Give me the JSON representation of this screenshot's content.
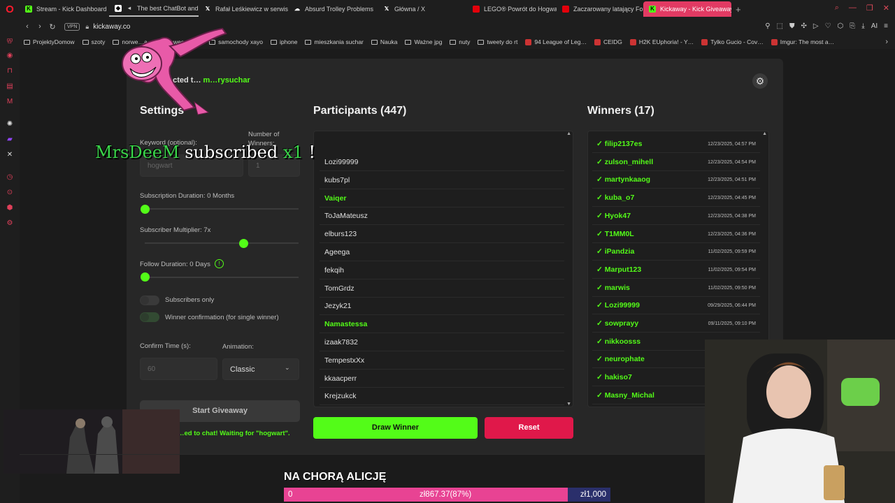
{
  "tabs": [
    {
      "label": "Stream - Kick Dashboard",
      "icon": "kick-icon",
      "color": "#53fc18"
    },
    {
      "label": "The best ChatBot and",
      "icon": "chatbot-icon",
      "color": "#ffffff"
    },
    {
      "label": "Rafał Leśkiewicz w serwis",
      "icon": "x-icon",
      "color": "#ffffff"
    },
    {
      "label": "Absurd Trolley Problems",
      "icon": "cloud-icon",
      "color": "#ffffff"
    },
    {
      "label": "Główna / X",
      "icon": "x-icon",
      "color": "#ffffff"
    },
    {
      "label": "LEGO® Powrót do Hogwa",
      "icon": "lego-icon",
      "color": "#e3000b"
    },
    {
      "label": "Zaczarowany latający Ford",
      "icon": "lego-icon",
      "color": "#e3000b"
    },
    {
      "label": "Kickaway - Kick Giveaway",
      "icon": "kick-icon",
      "color": "#53fc18",
      "active": true
    }
  ],
  "address": {
    "vpn": "VPN",
    "url": "kickaway.co",
    "ai": "AI"
  },
  "bookmarks": [
    {
      "label": "ProjektyDomow",
      "type": "folder"
    },
    {
      "label": "szoty",
      "type": "folder"
    },
    {
      "label": "norwe…a",
      "type": "folder"
    },
    {
      "label": "…owesamo…",
      "type": "folder"
    },
    {
      "label": "samochody xayo",
      "type": "folder"
    },
    {
      "label": "iphone",
      "type": "folder"
    },
    {
      "label": "mieszkania suchar",
      "type": "folder"
    },
    {
      "label": "Nauka",
      "type": "folder"
    },
    {
      "label": "Ważne jpg",
      "type": "folder"
    },
    {
      "label": "nuty",
      "type": "folder"
    },
    {
      "label": "tweety do rt",
      "type": "folder"
    },
    {
      "label": "94 League of Leg…",
      "type": "site"
    },
    {
      "label": "CEIDG",
      "type": "site"
    },
    {
      "label": "H2K EUphoria! - Y…",
      "type": "site"
    },
    {
      "label": "Tylko Gucio - Cov…",
      "type": "site"
    },
    {
      "label": "Imgur: The most a…",
      "type": "site"
    }
  ],
  "header": {
    "connected_prefix": "…ected t…",
    "connected_user": "m…rysuchar"
  },
  "settings": {
    "title": "Settings",
    "keyword_label": "Keyword (optional):",
    "keyword_value": "hogwart",
    "winners_label": "Number of Winners:",
    "winners_value": "1",
    "subscription_label": "Subscription Duration: 0 Months",
    "subscription_value": 0,
    "multiplier_label": "Subscriber Multiplier: 7x",
    "multiplier_value": 0.66,
    "follow_label": "Follow Duration: 0 Days",
    "follow_value": 0,
    "subs_only_label": "Subscribers only",
    "winner_confirm_label": "Winner confirmation (for single winner)",
    "confirm_time_label": "Confirm Time (s):",
    "confirm_time_value": "60",
    "animation_label": "Animation:",
    "animation_value": "Classic",
    "start_button": "Start Giveaway",
    "status": "…ed to chat! Waiting for \"hogwart\"."
  },
  "participants": {
    "title": "Participants (447)",
    "items": [
      {
        "name": "Lozi99999",
        "highlight": false
      },
      {
        "name": "kubs7pl",
        "highlight": false
      },
      {
        "name": "Vaiqer",
        "highlight": true
      },
      {
        "name": "ToJaMateusz",
        "highlight": false
      },
      {
        "name": "elburs123",
        "highlight": false
      },
      {
        "name": "Ageega",
        "highlight": false
      },
      {
        "name": "fekqih",
        "highlight": false
      },
      {
        "name": "TomGrdz",
        "highlight": false
      },
      {
        "name": "Jezyk21",
        "highlight": false
      },
      {
        "name": "Namastessa",
        "highlight": true
      },
      {
        "name": "izaak7832",
        "highlight": false
      },
      {
        "name": "TempestxXx",
        "highlight": false
      },
      {
        "name": "kkaacperr",
        "highlight": false
      },
      {
        "name": "Krejzukck",
        "highlight": false
      }
    ],
    "draw_button": "Draw Winner",
    "reset_button": "Reset"
  },
  "winners": {
    "title": "Winners (17)",
    "items": [
      {
        "name": "✓ filip2137es",
        "date": "12/23/2025, 04:57 PM"
      },
      {
        "name": "✓ zulson_mihell",
        "date": "12/23/2025, 04:54 PM"
      },
      {
        "name": "✓ martynkaaog",
        "date": "12/23/2025, 04:51 PM"
      },
      {
        "name": "✓ kuba_o7",
        "date": "12/23/2025, 04:45 PM"
      },
      {
        "name": "✓ Hyok47",
        "date": "12/23/2025, 04:38 PM"
      },
      {
        "name": "✓ T1MM0L",
        "date": "12/23/2025, 04:36 PM"
      },
      {
        "name": "✓ iPandzia",
        "date": "11/02/2025, 09:59 PM"
      },
      {
        "name": "✓ Marput123",
        "date": "11/02/2025, 09:54 PM"
      },
      {
        "name": "✓ marwis",
        "date": "11/02/2025, 09:50 PM"
      },
      {
        "name": "✓ Lozi99999",
        "date": "09/29/2025, 06:44 PM"
      },
      {
        "name": "✓ sowprayy",
        "date": "09/11/2025, 09:10 PM"
      },
      {
        "name": "✓ nikkoosss",
        "date": ""
      },
      {
        "name": "✓ neurophate",
        "date": ""
      },
      {
        "name": "✓ hakiso7",
        "date": ""
      },
      {
        "name": "✓ Masny_Michal",
        "date": ""
      }
    ]
  },
  "alert": {
    "user": "MrsDeeM",
    "text": "subscribed",
    "mult": "x1",
    "end": "!"
  },
  "goal": {
    "title": "NA CHORĄ ALICJĘ",
    "start": "0",
    "current": "zł867.37(87%)",
    "target": "zł1,000",
    "progress": 0.87
  },
  "colors": {
    "accent": "#53fc18",
    "danger": "#e0184a",
    "goal_fill": "#e84393",
    "goal_bg": "#2a2f6b"
  }
}
